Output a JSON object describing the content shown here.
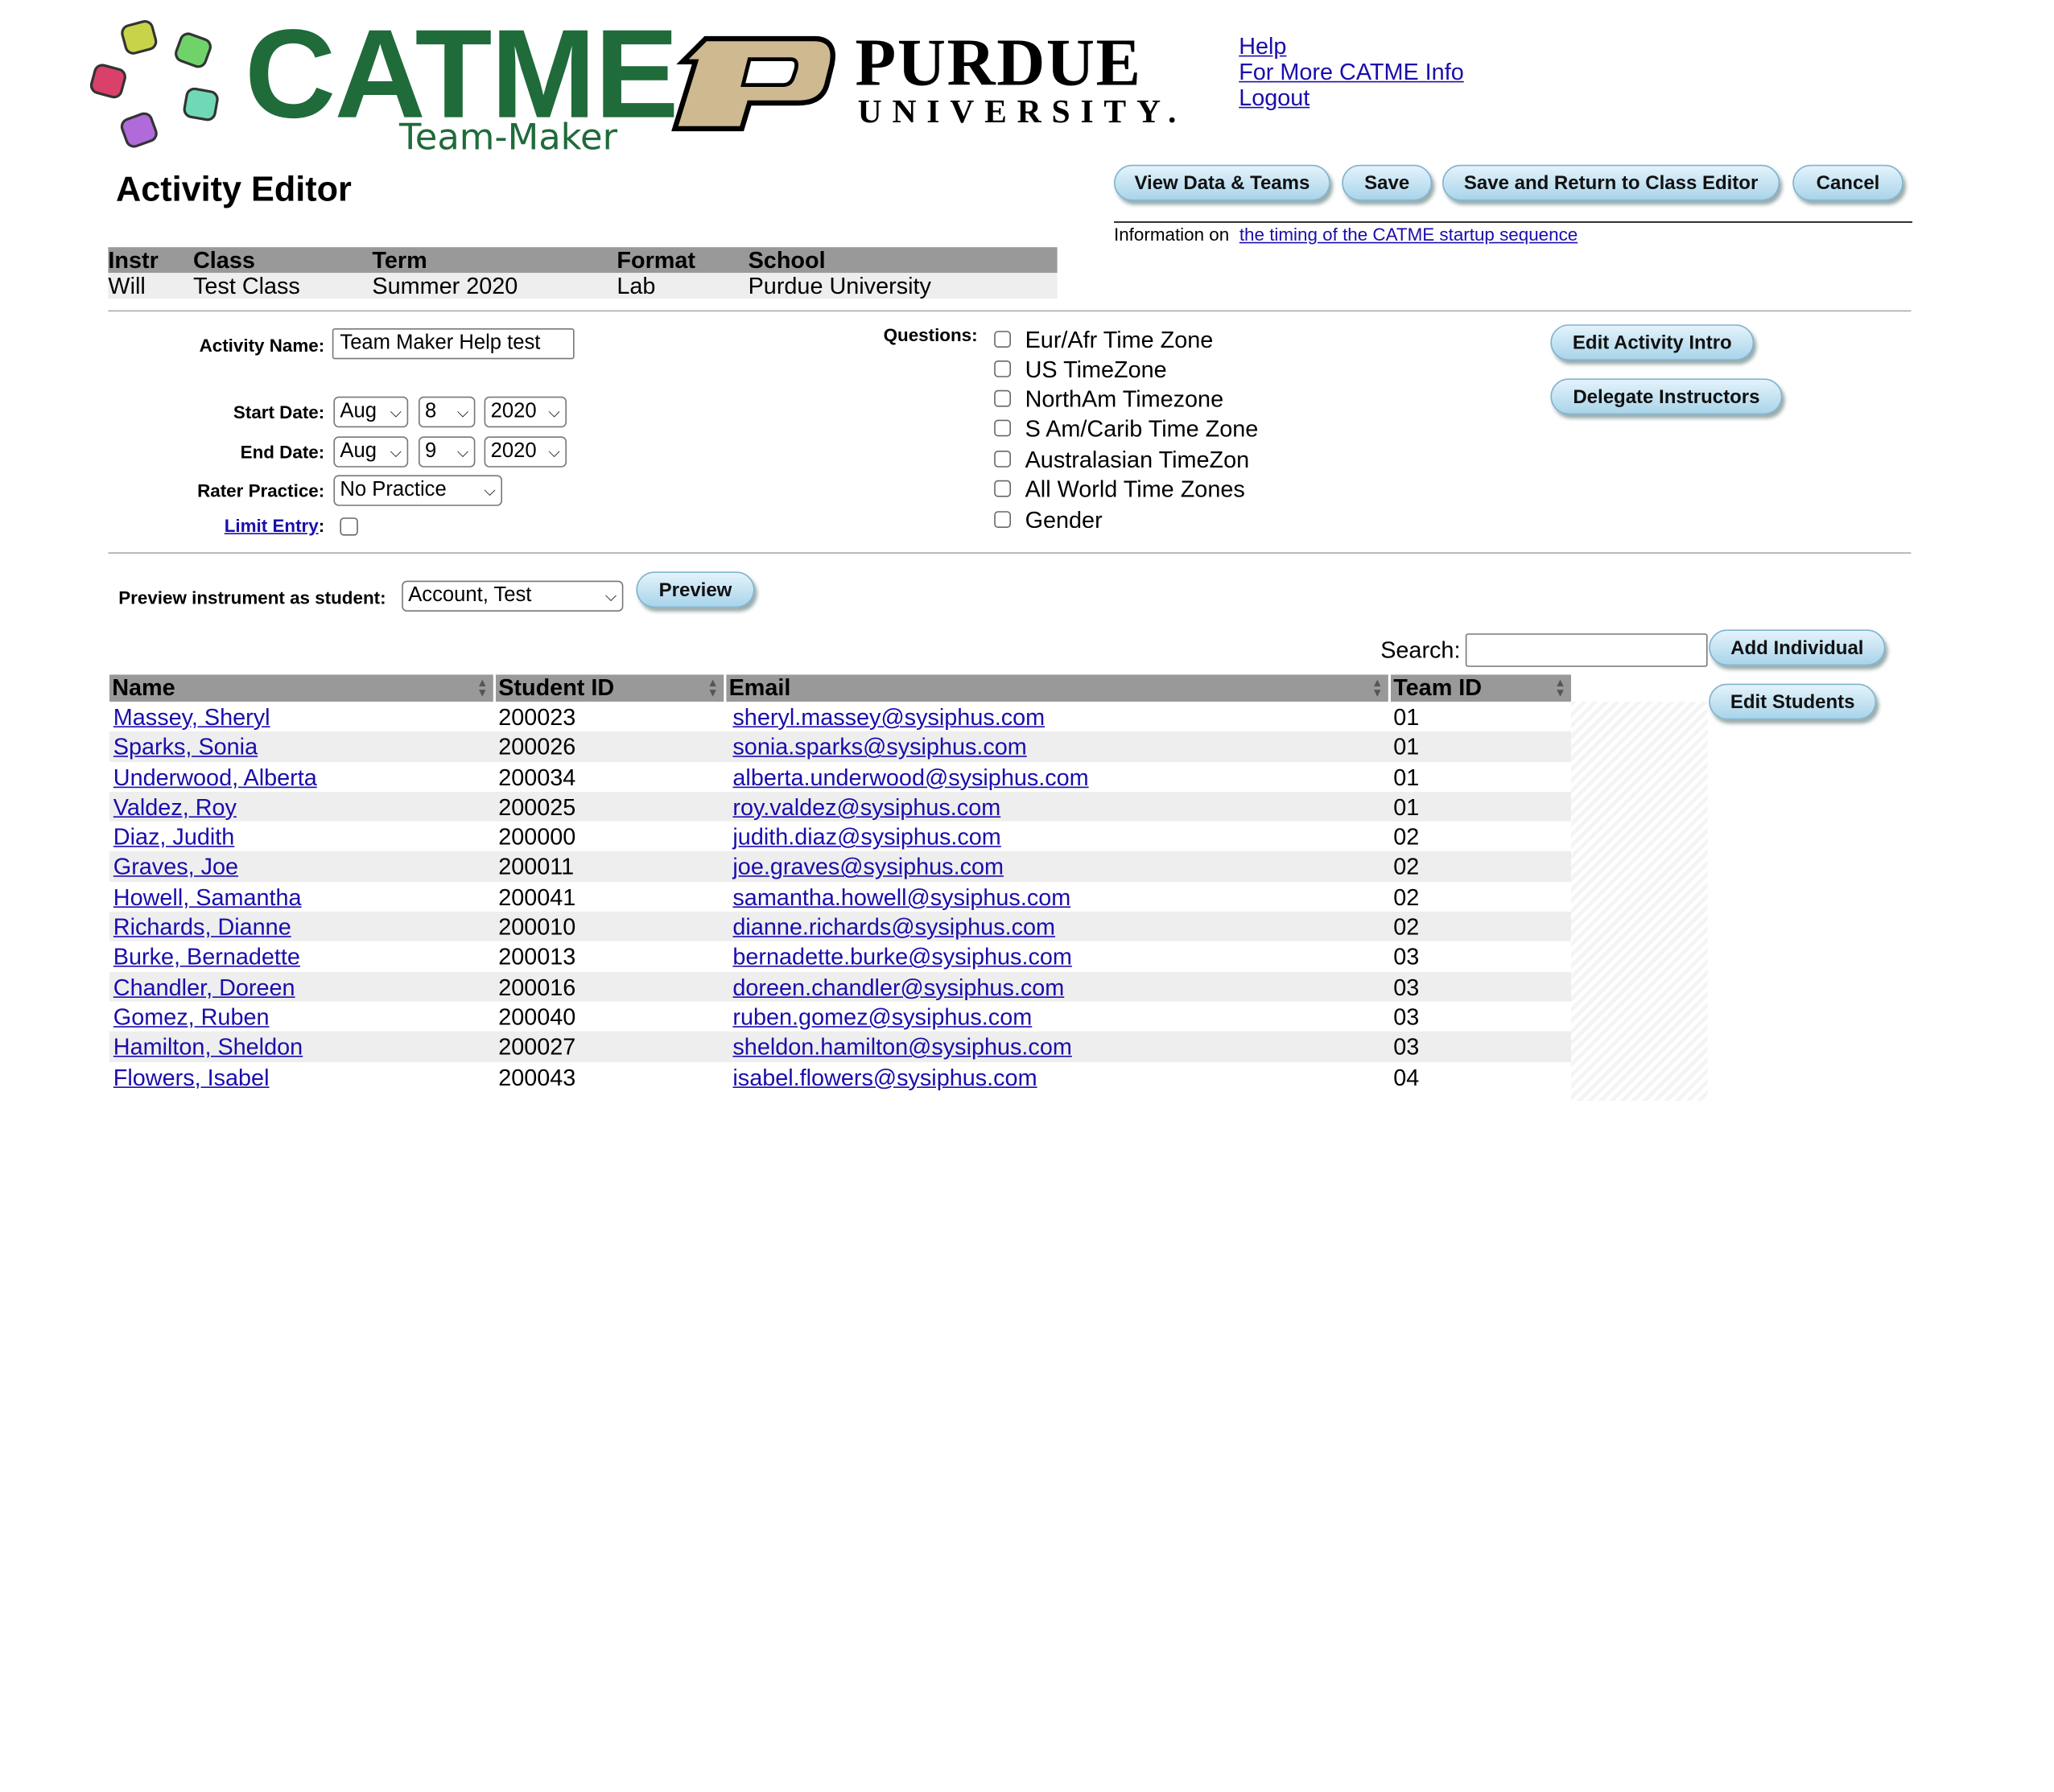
{
  "brand": {
    "catme_word": "CATME",
    "catme_sub": "Team-Maker",
    "purdue_word": "PURDUE",
    "purdue_sub": "UNIVERSITY."
  },
  "top_links": [
    "Help",
    "For More CATME Info",
    "Logout"
  ],
  "page_title": "Activity Editor",
  "actions": {
    "view_data": "View Data & Teams",
    "save": "Save",
    "save_return": "Save and Return to Class Editor",
    "cancel": "Cancel"
  },
  "timing": {
    "prefix": "Information on",
    "link": "the timing of the CATME startup sequence"
  },
  "class_info": {
    "headers": [
      "Instr",
      "Class",
      "Term",
      "Format",
      "School"
    ],
    "values": [
      "Will",
      "Test Class",
      "Summer 2020",
      "Lab",
      "Purdue University"
    ]
  },
  "form": {
    "activity_name_label": "Activity Name:",
    "activity_name": "Team Maker Help test",
    "start_label": "Start Date:",
    "start": {
      "month": "Aug",
      "day": "8",
      "year": "2020"
    },
    "end_label": "End Date:",
    "end": {
      "month": "Aug",
      "day": "9",
      "year": "2020"
    },
    "rater_label": "Rater Practice:",
    "rater_value": "No Practice",
    "limit_label": "Limit Entry",
    "limit_colon": ":"
  },
  "questions": {
    "label": "Questions:",
    "items": [
      "Eur/Afr Time Zone",
      "US TimeZone",
      "NorthAm Timezone",
      "S Am/Carib Time Zone",
      "Australasian TimeZon",
      "All World Time Zones",
      "Gender"
    ]
  },
  "side_buttons": {
    "edit_intro": "Edit Activity Intro",
    "delegate": "Delegate Instructors"
  },
  "preview": {
    "label": "Preview instrument as student:",
    "student": "Account, Test",
    "button": "Preview"
  },
  "search": {
    "label": "Search:",
    "value": ""
  },
  "student_buttons": {
    "add": "Add Individual",
    "edit": "Edit Students"
  },
  "students": {
    "headers": [
      "Name",
      "Student ID",
      "Email",
      "Team ID"
    ],
    "rows": [
      [
        "Massey, Sheryl",
        "200023",
        "sheryl.massey@sysiphus.com",
        "01"
      ],
      [
        "Sparks, Sonia",
        "200026",
        "sonia.sparks@sysiphus.com",
        "01"
      ],
      [
        "Underwood, Alberta",
        "200034",
        "alberta.underwood@sysiphus.com",
        "01"
      ],
      [
        "Valdez, Roy",
        "200025",
        "roy.valdez@sysiphus.com",
        "01"
      ],
      [
        "Diaz, Judith",
        "200000",
        "judith.diaz@sysiphus.com",
        "02"
      ],
      [
        "Graves, Joe",
        "200011",
        "joe.graves@sysiphus.com",
        "02"
      ],
      [
        "Howell, Samantha",
        "200041",
        "samantha.howell@sysiphus.com",
        "02"
      ],
      [
        "Richards, Dianne",
        "200010",
        "dianne.richards@sysiphus.com",
        "02"
      ],
      [
        "Burke, Bernadette",
        "200013",
        "bernadette.burke@sysiphus.com",
        "03"
      ],
      [
        "Chandler, Doreen",
        "200016",
        "doreen.chandler@sysiphus.com",
        "03"
      ],
      [
        "Gomez, Ruben",
        "200040",
        "ruben.gomez@sysiphus.com",
        "03"
      ],
      [
        "Hamilton, Sheldon",
        "200027",
        "sheldon.hamilton@sysiphus.com",
        "03"
      ],
      [
        "Flowers, Isabel",
        "200043",
        "isabel.flowers@sysiphus.com",
        "04"
      ]
    ]
  },
  "colors": {
    "catme_green": "#1f6b3a",
    "purdue_gold": "#cfb991",
    "link_blue": "#1a0dab",
    "header_gray": "#999999"
  }
}
